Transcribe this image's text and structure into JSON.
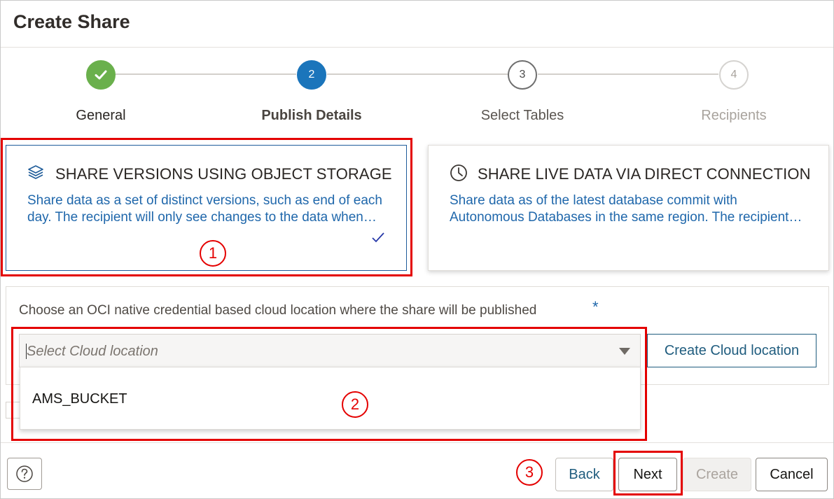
{
  "dialog": {
    "title": "Create Share"
  },
  "stepper": {
    "steps": [
      {
        "label": "General",
        "number": "1",
        "state": "completed"
      },
      {
        "label": "Publish Details",
        "number": "2",
        "state": "current"
      },
      {
        "label": "Select Tables",
        "number": "3",
        "state": "upcoming"
      },
      {
        "label": "Recipients",
        "number": "4",
        "state": "disabled"
      }
    ]
  },
  "options": {
    "object_storage": {
      "title": "SHARE VERSIONS USING OBJECT STORAGE",
      "line1": "Share data as a set of distinct versions, such as end of each",
      "line2": "day. The recipient will only see changes to the data when…",
      "selected": true,
      "icon": "layers-icon"
    },
    "live_data": {
      "title": "SHARE LIVE DATA VIA DIRECT CONNECTION",
      "line1": "Share data as of the latest database commit with",
      "line2": "Autonomous Databases in the same region. The recipient…",
      "selected": false,
      "icon": "clock-icon"
    }
  },
  "location": {
    "label": "Choose an OCI native credential based cloud location where the share will be published",
    "required_mark": "*",
    "placeholder": "Select Cloud location",
    "options": [
      "AMS_BUCKET"
    ],
    "create_button": "Create Cloud location"
  },
  "annotations": {
    "callout_1": "1",
    "callout_2": "2",
    "callout_3": "3",
    "color": "#e40000"
  },
  "footer": {
    "help_icon": "help-icon",
    "back": "Back",
    "next": "Next",
    "create": "Create",
    "cancel": "Cancel"
  },
  "colors": {
    "accent_blue": "#1b75bb",
    "complete_green": "#6ab04c",
    "link_blue": "#1f67ab"
  }
}
